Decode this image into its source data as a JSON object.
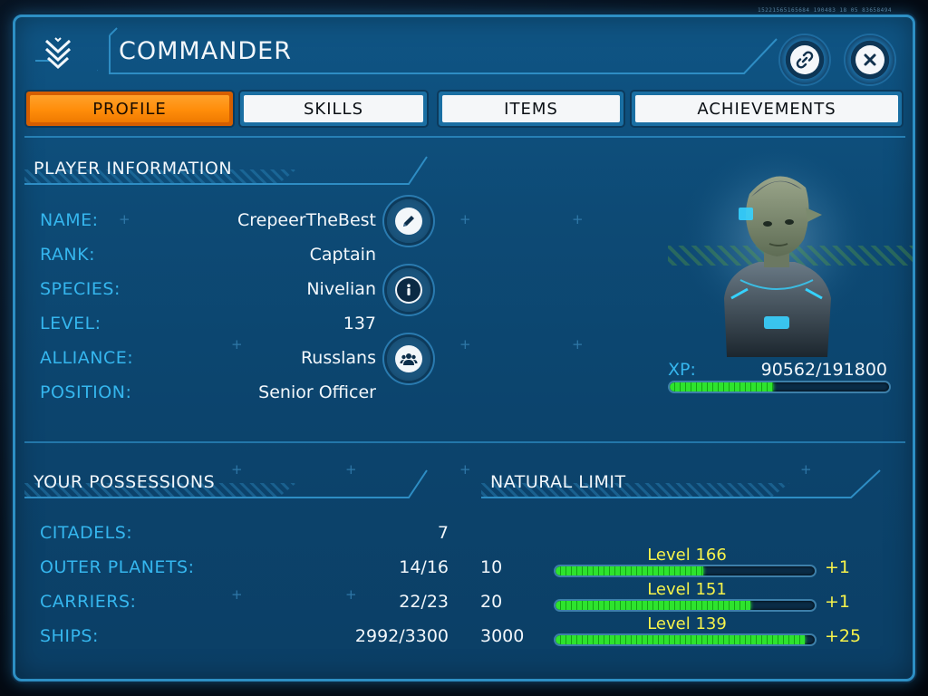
{
  "header": {
    "title": "COMMANDER",
    "corner_code": "15221565165684 190483 18 05 83658494"
  },
  "tabs": [
    {
      "label": "PROFILE",
      "active": true
    },
    {
      "label": "SKILLS",
      "active": false
    },
    {
      "label": "ITEMS",
      "active": false
    },
    {
      "label": "ACHIEVEMENTS",
      "active": false
    }
  ],
  "player_info": {
    "title": "PLAYER INFORMATION",
    "rows": [
      {
        "label": "NAME:",
        "value": "CrepeerTheBest"
      },
      {
        "label": "RANK:",
        "value": "Captain"
      },
      {
        "label": "SPECIES:",
        "value": "Nivelian"
      },
      {
        "label": "LEVEL:",
        "value": "137"
      },
      {
        "label": "ALLIANCE:",
        "value": "Russlans"
      },
      {
        "label": "POSITION:",
        "value": "Senior Officer"
      }
    ],
    "xp": {
      "label": "XP:",
      "value": "90562/191800",
      "current": 90562,
      "max": 191800
    }
  },
  "possessions": {
    "title": "YOUR POSSESSIONS",
    "rows": [
      {
        "label": "CITADELS:",
        "value": "7"
      },
      {
        "label": "OUTER PLANETS:",
        "value": "14/16"
      },
      {
        "label": "CARRIERS:",
        "value": "22/23"
      },
      {
        "label": "SHIPS:",
        "value": "2992/3300"
      }
    ]
  },
  "natural_limit": {
    "title": "NATURAL LIMIT",
    "rows": [
      {
        "limit": "10",
        "level": "Level 166",
        "bonus": "+1",
        "progress": 0.57
      },
      {
        "limit": "20",
        "level": "Level 151",
        "bonus": "+1",
        "progress": 0.75
      },
      {
        "limit": "3000",
        "level": "Level 139",
        "bonus": "+25",
        "progress": 0.96
      }
    ]
  },
  "colors": {
    "accent": "#35b6ee",
    "active_tab": "#ff8d0a",
    "level_text": "#f7f34a",
    "bar_fill": "#2ee32e"
  },
  "icons": {
    "header": "chevron-emblem-icon",
    "link": "link-icon",
    "close": "close-icon",
    "edit": "pencil-icon",
    "info": "info-icon",
    "alliance": "group-icon"
  }
}
